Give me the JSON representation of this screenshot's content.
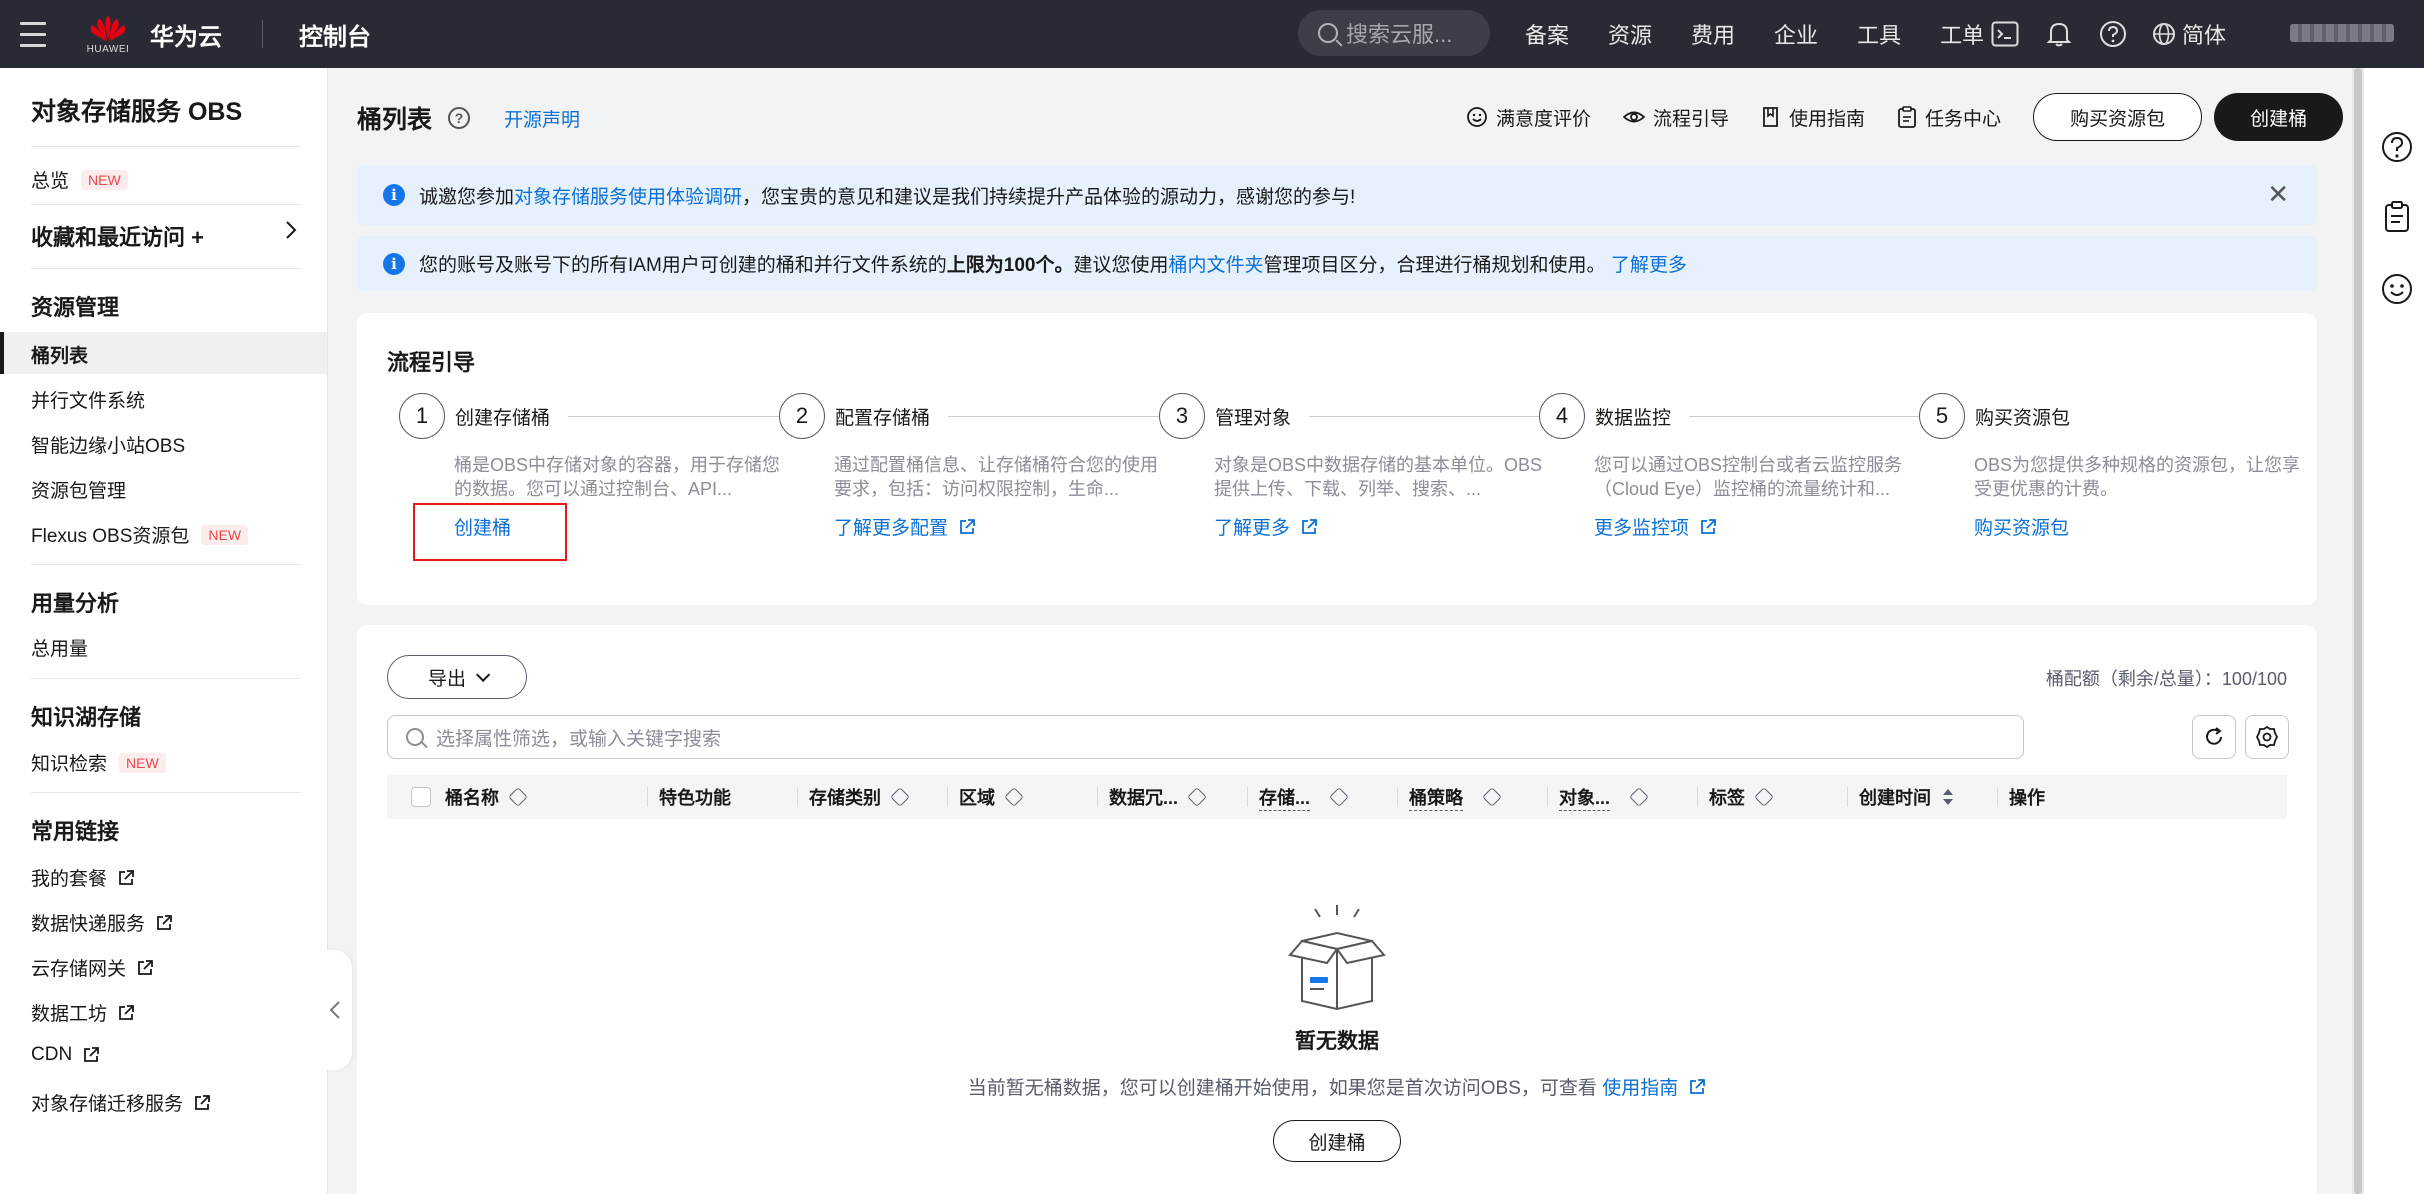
{
  "topbar": {
    "logo_text": "HUAWEI",
    "cloud_name": "华为云",
    "console": "控制台",
    "search_placeholder": "搜索云服...",
    "links": [
      "备案",
      "资源",
      "费用",
      "企业",
      "工具",
      "工单"
    ],
    "lang": "简体"
  },
  "sidebar": {
    "title": "对象存储服务 OBS",
    "overview": "总览",
    "new_badge": "NEW",
    "favorites": "收藏和最近访问 +",
    "resource_mgmt": "资源管理",
    "items_resource": [
      "桶列表",
      "并行文件系统",
      "智能边缘小站OBS",
      "资源包管理",
      "Flexus OBS资源包"
    ],
    "usage_analysis": "用量分析",
    "total_usage": "总用量",
    "knowledge_lake": "知识湖存储",
    "knowledge_search": "知识检索",
    "common_links": "常用链接",
    "links": [
      "我的套餐",
      "数据快递服务",
      "云存储网关",
      "数据工坊",
      "CDN",
      "对象存储迁移服务"
    ]
  },
  "header": {
    "title": "桶列表",
    "open_source": "开源声明",
    "actions": [
      "满意度评价",
      "流程引导",
      "使用指南",
      "任务中心"
    ],
    "buy_pkg": "购买资源包",
    "create_bucket": "创建桶"
  },
  "notice1": {
    "pre": "诚邀您参加",
    "link": "对象存储服务使用体验调研",
    "post": "，您宝贵的意见和建议是我们持续提升产品体验的源动力，感谢您的参与!"
  },
  "notice2": {
    "pre": "您的账号及账号下的所有IAM用户可创建的桶和并行文件系统的",
    "bold": "上限为100个。",
    "mid": " 建议您使用",
    "link1": "桶内文件夹",
    "post": "管理项目区分，合理进行桶规划和使用。",
    "link2": "了解更多"
  },
  "flow": {
    "title": "流程引导",
    "steps": [
      {
        "num": "1",
        "name": "创建存储桶",
        "desc": "桶是OBS中存储对象的容器，用于存储您的数据。您可以通过控制台、API...",
        "link": "创建桶"
      },
      {
        "num": "2",
        "name": "配置存储桶",
        "desc": "通过配置桶信息、让存储桶符合您的使用要求，包括：访问权限控制，生命...",
        "link": "了解更多配置"
      },
      {
        "num": "3",
        "name": "管理对象",
        "desc": "对象是OBS中数据存储的基本单位。OBS提供上传、下载、列举、搜索、...",
        "link": "了解更多"
      },
      {
        "num": "4",
        "name": "数据监控",
        "desc": "您可以通过OBS控制台或者云监控服务（Cloud Eye）监控桶的流量统计和...",
        "link": "更多监控项"
      },
      {
        "num": "5",
        "name": "购买资源包",
        "desc": "OBS为您提供多种规格的资源包，让您享受更优惠的计费。",
        "link": "购买资源包"
      }
    ]
  },
  "table": {
    "export": "导出",
    "quota": "桶配额（剩余/总量）：100/100",
    "filter_placeholder": "选择属性筛选，或输入关键字搜索",
    "columns": [
      "桶名称",
      "特色功能",
      "存储类别",
      "区域",
      "数据冗...",
      "存储...",
      "桶策略",
      "对象...",
      "标签",
      "创建时间",
      "操作"
    ],
    "empty_title": "暂无数据",
    "empty_desc": "当前暂无桶数据，您可以创建桶开始使用，如果您是首次访问OBS，可查看",
    "empty_link": "使用指南",
    "empty_button": "创建桶"
  }
}
